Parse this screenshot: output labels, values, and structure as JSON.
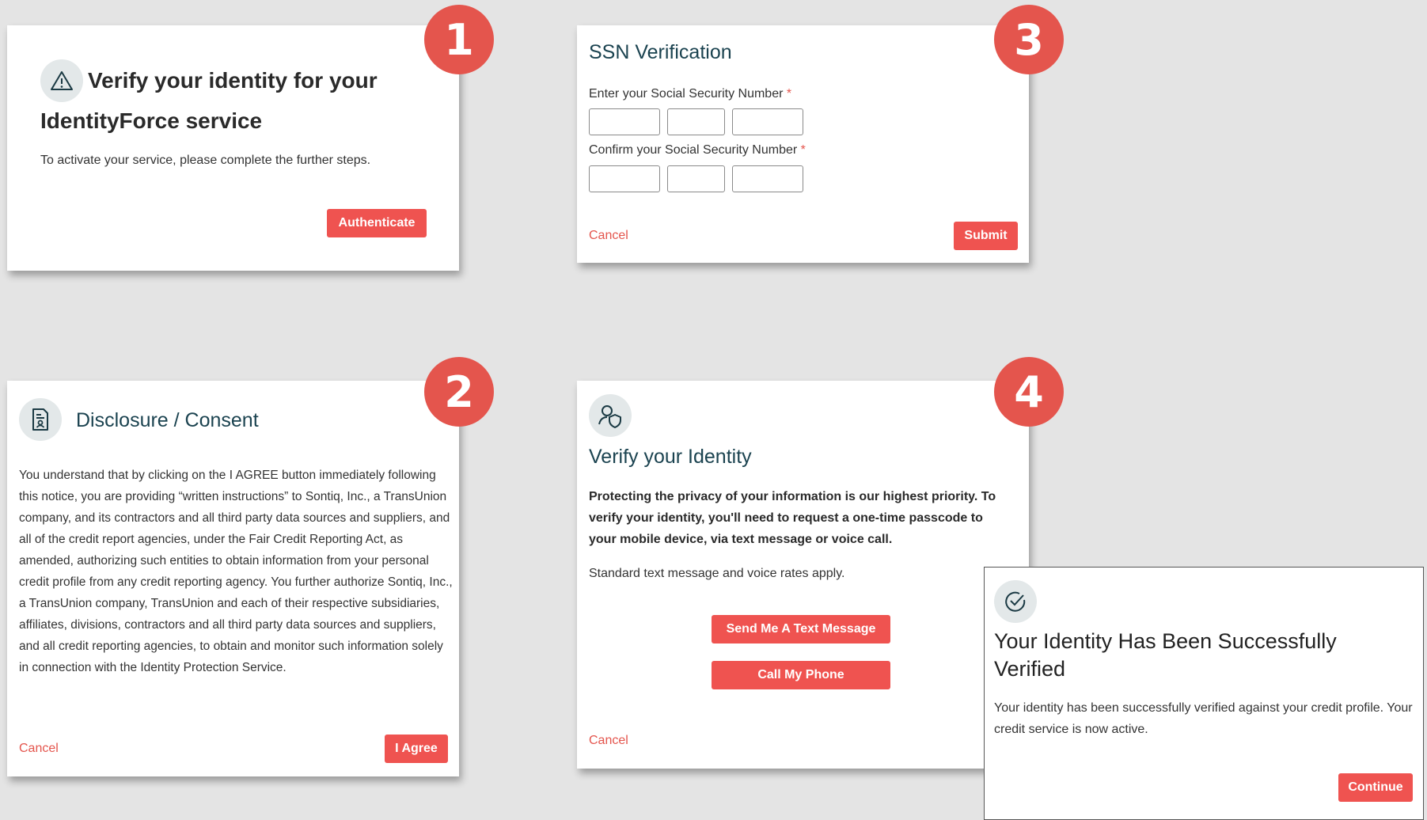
{
  "badges": [
    "1",
    "2",
    "3",
    "4"
  ],
  "card1": {
    "title": "Verify your identity for your IdentityForce service",
    "subtitle": "To activate your service, please complete the further steps.",
    "authenticate_label": "Authenticate",
    "icon": "warning-triangle-icon"
  },
  "card2": {
    "title": "Disclosure / Consent",
    "body": "You understand that by clicking on the I AGREE button immediately following this notice, you are providing “written instructions” to Sontiq, Inc., a TransUnion company, and its contractors and all third party data sources and suppliers, and all of the credit report agencies, under the Fair Credit Reporting Act, as amended, authorizing such entities to obtain information from your personal credit profile from any credit reporting agency. You further authorize Sontiq, Inc., a TransUnion company, TransUnion and each of their respective subsidiaries, affiliates, divisions, contractors and all third party data sources and suppliers, and all credit reporting agencies, to obtain and monitor such information solely in connection with the Identity Protection Service.",
    "cancel_label": "Cancel",
    "agree_label": "I Agree",
    "icon": "document-icon"
  },
  "card3": {
    "title": "SSN Verification",
    "enter_label": "Enter your Social Security Number",
    "confirm_label": "Confirm your Social Security Number",
    "required_mark": "*",
    "cancel_label": "Cancel",
    "submit_label": "Submit"
  },
  "card4": {
    "title": "Verify your Identity",
    "bold_text": "Protecting the privacy of your information is our highest priority. To verify your identity, you'll need to request a one-time passcode to your mobile device, via text message or voice call.",
    "rates_text": "Standard text message and voice rates apply.",
    "text_button_label": "Send Me A Text Message",
    "call_button_label": "Call My Phone",
    "cancel_label": "Cancel",
    "icon": "user-shield-icon"
  },
  "card5": {
    "title": "Your Identity Has Been Successfully Verified",
    "body": "Your identity has been successfully verified against your credit profile. Your credit service is now active.",
    "continue_label": "Continue",
    "icon": "check-circle-icon"
  },
  "colors": {
    "accent": "#ef5350",
    "badge": "#e4554d",
    "title_teal": "#1b4350",
    "background": "#e4e4e4"
  }
}
